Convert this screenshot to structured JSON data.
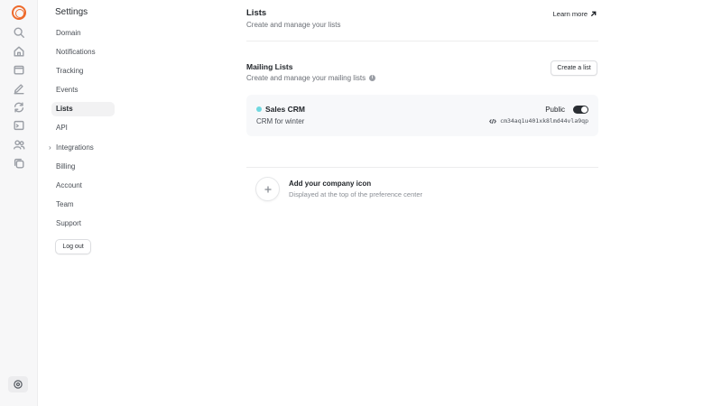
{
  "app": {
    "accent_color": "#ee6a2b"
  },
  "rail": {
    "icons": [
      "search-icon",
      "home-icon",
      "inbox-icon",
      "edit-icon",
      "sync-icon",
      "terminal-icon",
      "users-icon",
      "copy-icon"
    ],
    "bottom_icon": "settings-icon"
  },
  "sidebar": {
    "title": "Settings",
    "items": [
      {
        "label": "Domain"
      },
      {
        "label": "Notifications"
      },
      {
        "label": "Tracking"
      },
      {
        "label": "Events"
      },
      {
        "label": "Lists",
        "active": true
      },
      {
        "label": "API"
      },
      {
        "label": "Integrations",
        "expandable": true
      },
      {
        "label": "Billing"
      },
      {
        "label": "Account"
      },
      {
        "label": "Team"
      },
      {
        "label": "Support"
      }
    ],
    "logout_label": "Log out"
  },
  "main": {
    "title": "Lists",
    "subtitle": "Create and manage your lists",
    "learn_more": "Learn more",
    "mailing": {
      "title": "Mailing Lists",
      "subtitle": "Create and manage your mailing lists",
      "create_label": "Create a list"
    },
    "lists": [
      {
        "name": "Sales CRM",
        "description": "CRM for winter",
        "visibility": "Public",
        "public_on": true,
        "id": "cm34aq1u401xk8lmd44vla9qp",
        "color": "#6fd8e0"
      }
    ],
    "company_icon": {
      "title": "Add your company icon",
      "subtitle": "Displayed at the top of the preference center"
    }
  }
}
